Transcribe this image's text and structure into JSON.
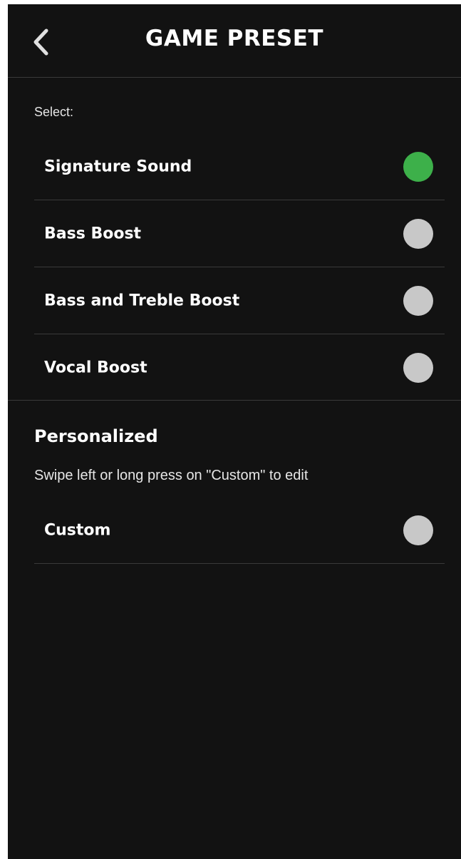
{
  "header": {
    "title": "GAME PRESET",
    "back_icon": "chevron-left-icon"
  },
  "presets": {
    "label": "Select:",
    "items": [
      {
        "label": "Signature Sound",
        "selected": true
      },
      {
        "label": "Bass Boost",
        "selected": false
      },
      {
        "label": "Bass and Treble Boost",
        "selected": false
      },
      {
        "label": "Vocal Boost",
        "selected": false
      }
    ]
  },
  "personalized": {
    "heading": "Personalized",
    "hint": "Swipe left or long press on \"Custom\" to edit",
    "items": [
      {
        "label": "Custom",
        "selected": false
      }
    ]
  },
  "colors": {
    "background": "#121212",
    "selected": "#3db04a",
    "unselected": "#c8c8c8",
    "divider": "#3a3a3a"
  }
}
